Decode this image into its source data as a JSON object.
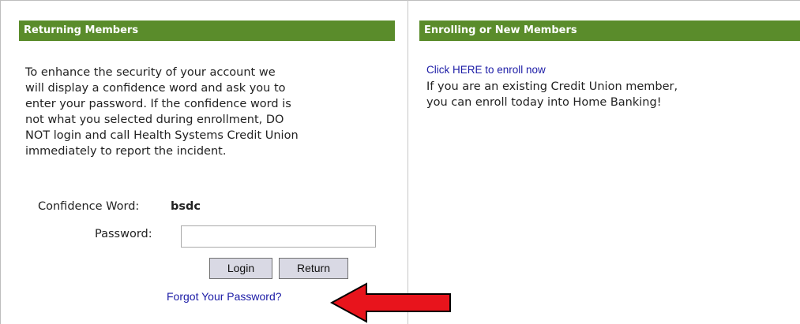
{
  "returning": {
    "header": "Returning Members",
    "description": "To enhance the security of your account we\nwill display a confidence word and ask you to\nenter your password. If the confidence word is\nnot what you selected during enrollment, DO\nNOT login and call Health Systems Credit Union\nimmediately to report the incident.",
    "confidence_label": "Confidence Word:",
    "confidence_word": "bsdc",
    "password_label": "Password:",
    "password_value": "",
    "login_label": "Login",
    "return_label": "Return",
    "forgot_label": "Forgot Your Password?"
  },
  "enrolling": {
    "header": "Enrolling or New Members",
    "enroll_link": "Click HERE to enroll now",
    "description": "If you are an existing Credit Union member,\nyou can enroll today into Home Banking!"
  },
  "annotation": {
    "arrow_icon": "red-arrow-icon",
    "arrow_color": "#e8141c"
  },
  "colors": {
    "header_bg": "#5a8c2b",
    "link": "#1b1ba6",
    "button_bg": "#d9d9e4"
  }
}
